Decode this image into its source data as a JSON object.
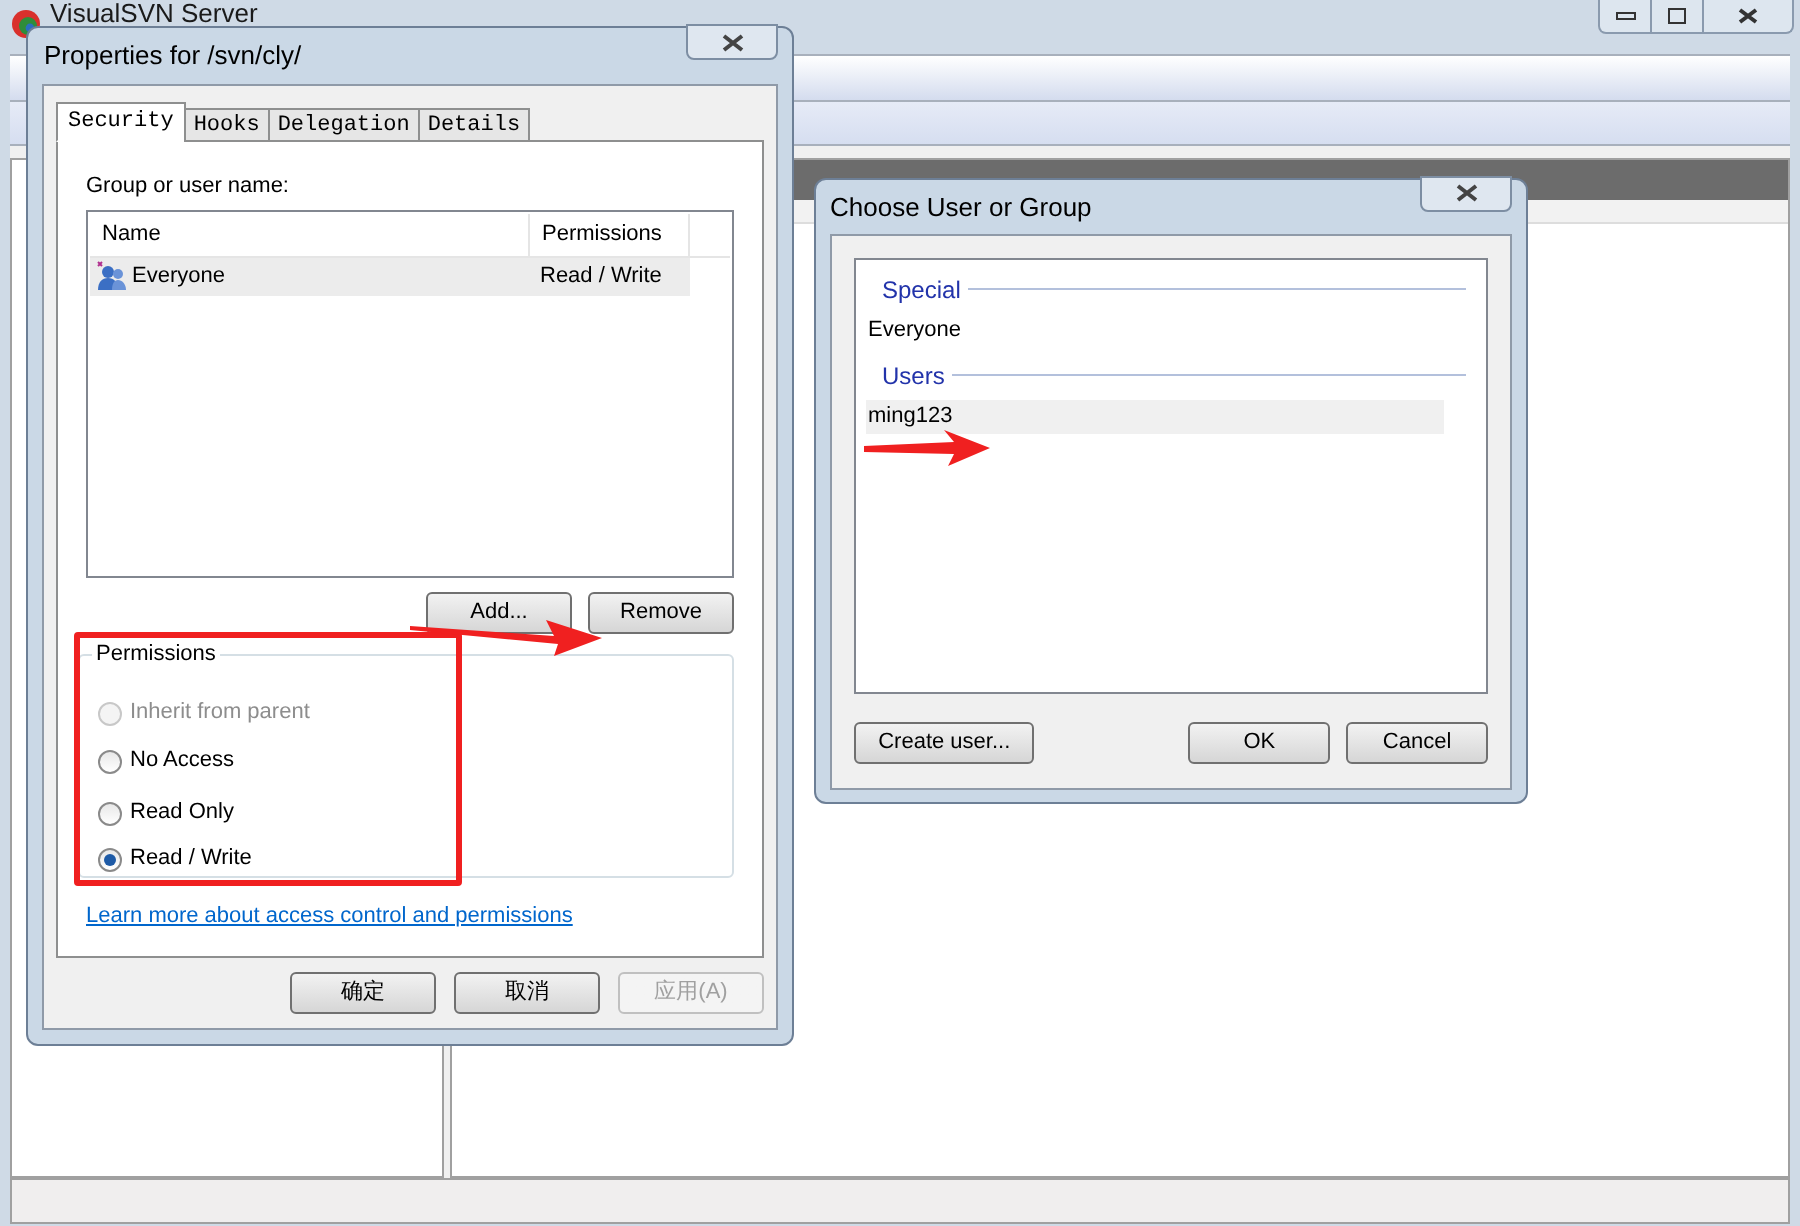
{
  "main_window": {
    "title": "VisualSVN Server"
  },
  "properties_dialog": {
    "title": "Properties for /svn/cly/",
    "tabs": [
      {
        "label": "Security",
        "selected": true
      },
      {
        "label": "Hooks",
        "selected": false
      },
      {
        "label": "Delegation",
        "selected": false
      },
      {
        "label": "Details",
        "selected": false
      }
    ],
    "list_label": "Group or user name:",
    "columns": [
      "Name",
      "Permissions"
    ],
    "rows": [
      {
        "name": "Everyone",
        "permissions": "Read / Write",
        "selected": true
      }
    ],
    "list_buttons": [
      "Add...",
      "Remove"
    ],
    "permissions": {
      "title": "Permissions",
      "options": [
        {
          "label": "Inherit from parent",
          "selected": false,
          "disabled": true
        },
        {
          "label": "No Access",
          "selected": false,
          "disabled": false
        },
        {
          "label": "Read Only",
          "selected": false,
          "disabled": false
        },
        {
          "label": "Read / Write",
          "selected": true,
          "disabled": false
        }
      ]
    },
    "link": "Learn more about access control and permissions",
    "buttons": [
      {
        "label": "确定",
        "disabled": false
      },
      {
        "label": "取消",
        "disabled": false
      },
      {
        "label": "应用(A)",
        "disabled": true
      }
    ]
  },
  "choose_dialog": {
    "title": "Choose User or Group",
    "groups": [
      {
        "heading": "Special",
        "items": [
          {
            "label": "Everyone",
            "selected": false
          }
        ]
      },
      {
        "heading": "Users",
        "items": [
          {
            "label": "ming123",
            "selected": true
          }
        ]
      }
    ],
    "buttons": [
      "Create user...",
      "OK",
      "Cancel"
    ]
  }
}
